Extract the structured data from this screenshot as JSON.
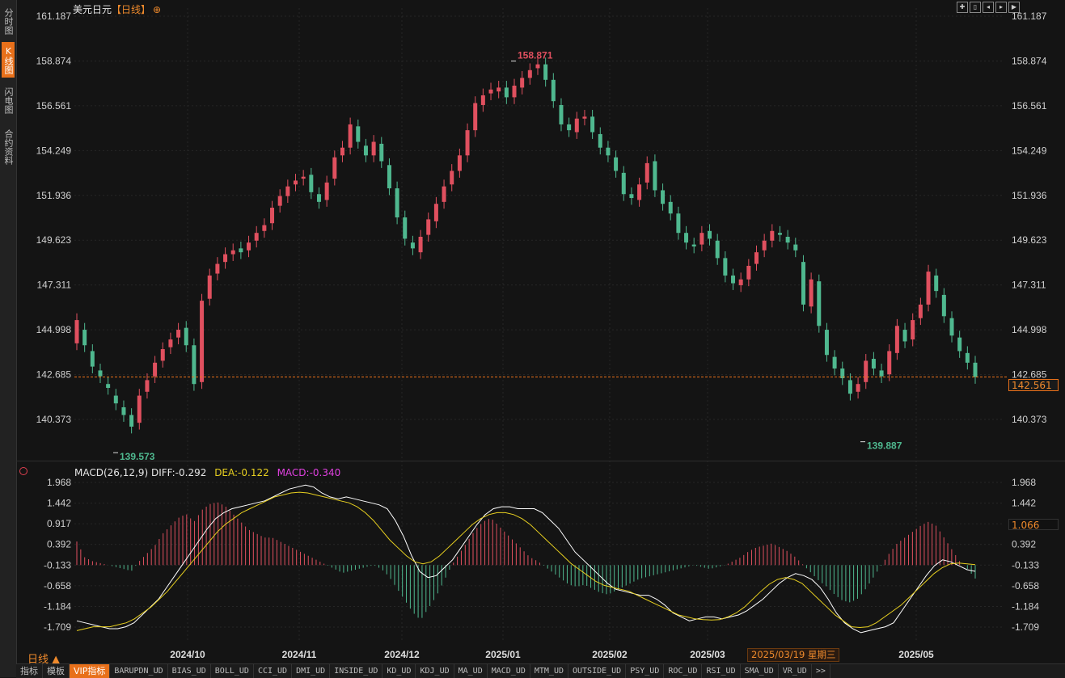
{
  "sidebar": {
    "tabs": [
      {
        "label": "分时图",
        "active": false
      },
      {
        "label": "K线图",
        "active": true
      },
      {
        "label": "闪电图",
        "active": false
      },
      {
        "label": "合约资料",
        "active": false
      }
    ]
  },
  "header": {
    "symbol": "美元日元",
    "period": "【日线】",
    "add_icon": "add-circle-icon"
  },
  "window_controls": [
    "expand-icon",
    "split-icon",
    "prev-icon",
    "next-icon",
    "play-icon"
  ],
  "price_axis": {
    "ticks": [
      "161.187",
      "158.874",
      "156.561",
      "154.249",
      "151.936",
      "149.623",
      "147.311",
      "144.998",
      "142.685",
      "140.373"
    ],
    "current_price": "142.561",
    "right_ticks": [
      "161.187",
      "158.874",
      "156.561",
      "154.249",
      "151.936",
      "149.623",
      "147.311",
      "144.998",
      "142.685",
      "140.373"
    ]
  },
  "annotations": {
    "high": "158.871",
    "low1": "139.573",
    "low2": "139.887"
  },
  "macd": {
    "title": "MACD(26,12,9)",
    "diff": "DIFF:-0.292",
    "dea": "DEA:-0.122",
    "macd": "MACD:-0.340",
    "ticks": [
      "1.968",
      "1.442",
      "0.917",
      "0.392",
      "-0.133",
      "-0.658",
      "-1.184",
      "-1.709"
    ],
    "right_ticks": [
      "1.968",
      "1.442",
      "0.917",
      "0.392",
      "-0.133",
      "-0.658",
      "-1.184",
      "-1.709"
    ],
    "cursor_value": "1.066"
  },
  "time_axis": {
    "labels": [
      "2024/10",
      "2024/11",
      "2024/12",
      "2025/01",
      "2025/02",
      "2025/03",
      "2025/05"
    ],
    "cursor_date": "2025/03/19 星期三"
  },
  "period_toggle": "日线 ▲",
  "bottom_tabs": [
    {
      "label": "指标",
      "active": false
    },
    {
      "label": "模板",
      "active": false
    },
    {
      "label": "VIP指标",
      "active": true
    },
    {
      "label": "BARUPDN_UD",
      "active": false
    },
    {
      "label": "BIAS_UD",
      "active": false
    },
    {
      "label": "BOLL_UD",
      "active": false
    },
    {
      "label": "CCI_UD",
      "active": false
    },
    {
      "label": "DMI_UD",
      "active": false
    },
    {
      "label": "INSIDE_UD",
      "active": false
    },
    {
      "label": "KD_UD",
      "active": false
    },
    {
      "label": "KDJ_UD",
      "active": false
    },
    {
      "label": "MA_UD",
      "active": false
    },
    {
      "label": "MACD_UD",
      "active": false
    },
    {
      "label": "MTM_UD",
      "active": false
    },
    {
      "label": "OUTSIDE_UD",
      "active": false
    },
    {
      "label": "PSY_UD",
      "active": false
    },
    {
      "label": "ROC_UD",
      "active": false
    },
    {
      "label": "RSI_UD",
      "active": false
    },
    {
      "label": "SMA_UD",
      "active": false
    },
    {
      "label": "VR_UD",
      "active": false
    },
    {
      "label": ">>",
      "active": false
    }
  ],
  "colors": {
    "up": "#e0505f",
    "down": "#4fb88f",
    "diff_line": "#ffffff",
    "dea_line": "#e8d020",
    "accent": "#e8701a",
    "price_line": "#e8701a"
  },
  "chart_data": [
    {
      "type": "candlestick",
      "title": "美元日元",
      "ylim": [
        139.0,
        161.187
      ],
      "x_labels": [
        "2024/10",
        "2024/11",
        "2024/12",
        "2025/01",
        "2025/02",
        "2025/03",
        "2025/05"
      ],
      "closes": [
        145.5,
        144.2,
        143.1,
        142.6,
        142.0,
        141.2,
        140.6,
        140.0,
        141.6,
        142.4,
        143.3,
        144.0,
        144.5,
        145.0,
        144.2,
        142.2,
        146.5,
        147.8,
        148.4,
        148.9,
        149.1,
        149.0,
        149.5,
        150.0,
        150.4,
        151.3,
        151.9,
        152.4,
        152.7,
        152.9,
        152.1,
        151.6,
        152.6,
        153.9,
        154.4,
        155.6,
        154.7,
        154.0,
        154.7,
        153.7,
        152.3,
        150.8,
        149.7,
        149.2,
        149.8,
        150.7,
        151.5,
        152.4,
        153.2,
        154.0,
        155.3,
        156.7,
        157.1,
        157.4,
        157.5,
        157.0,
        157.6,
        158.0,
        158.4,
        158.7,
        157.9,
        156.8,
        155.6,
        155.3,
        155.9,
        156.0,
        155.2,
        154.4,
        154.0,
        153.2,
        152.0,
        151.8,
        152.5,
        153.6,
        152.2,
        151.5,
        151.0,
        150.0,
        149.5,
        149.3,
        150.0,
        149.7,
        148.7,
        147.8,
        147.4,
        147.6,
        148.3,
        149.0,
        149.6,
        150.1,
        149.9,
        149.5,
        149.1,
        146.3,
        147.6,
        145.2,
        143.7,
        143.0,
        142.5,
        141.7,
        142.2,
        143.4,
        143.0,
        142.6,
        143.9,
        145.2,
        144.4,
        145.5,
        146.3,
        148.0,
        147.0,
        145.7,
        144.7,
        143.9,
        143.3,
        142.561
      ],
      "opens": [
        144.3,
        145.0,
        143.9,
        142.9,
        142.2,
        141.6,
        141.0,
        140.6,
        140.2,
        141.8,
        142.6,
        143.4,
        144.1,
        144.6,
        145.1,
        144.2,
        142.3,
        146.6,
        147.9,
        148.5,
        148.9,
        149.2,
        149.1,
        149.6,
        150.1,
        150.5,
        151.4,
        151.9,
        152.5,
        152.8,
        153.0,
        152.0,
        151.7,
        152.8,
        154.0,
        154.4,
        155.5,
        154.5,
        154.0,
        154.6,
        153.5,
        152.3,
        150.8,
        149.5,
        149.0,
        149.9,
        150.6,
        151.6,
        152.5,
        153.2,
        154.0,
        155.3,
        156.6,
        157.2,
        157.3,
        157.5,
        157.0,
        157.5,
        158.0,
        158.5,
        158.7,
        157.9,
        156.6,
        155.6,
        155.2,
        155.9,
        156.0,
        155.1,
        154.4,
        153.9,
        153.1,
        152.0,
        151.7,
        152.6,
        153.7,
        152.2,
        151.6,
        151.0,
        150.0,
        149.4,
        149.4,
        150.1,
        149.6,
        148.7,
        147.8,
        147.3,
        147.6,
        148.4,
        149.1,
        149.6,
        150.0,
        149.8,
        149.4,
        148.5,
        146.2,
        147.5,
        145.0,
        143.6,
        143.0,
        142.4,
        141.8,
        142.3,
        143.5,
        142.9,
        142.7,
        143.8,
        145.0,
        144.5,
        145.6,
        146.3,
        147.8,
        146.8,
        145.6,
        144.6,
        143.8,
        143.3
      ]
    },
    {
      "type": "bar",
      "title": "MACD(26,12,9)",
      "ylim": [
        -2.0,
        1.968
      ],
      "series": [
        {
          "name": "MACD",
          "values": [
            0.6,
            0.2,
            0.1,
            0.05,
            0.0,
            -0.05,
            -0.1,
            -0.15,
            0.1,
            0.3,
            0.5,
            0.8,
            1.0,
            1.2,
            1.3,
            1.1,
            1.4,
            1.55,
            1.6,
            1.5,
            1.3,
            1.1,
            0.9,
            0.8,
            0.7,
            0.7,
            0.6,
            0.5,
            0.4,
            0.3,
            0.2,
            0.1,
            0.0,
            -0.1,
            -0.2,
            -0.15,
            -0.1,
            -0.05,
            0.0,
            -0.1,
            -0.3,
            -0.6,
            -0.9,
            -1.2,
            -1.4,
            -1.1,
            -0.8,
            -0.4,
            0.0,
            0.3,
            0.6,
            0.9,
            1.1,
            1.2,
            1.0,
            0.8,
            0.6,
            0.4,
            0.2,
            0.1,
            -0.05,
            -0.2,
            -0.35,
            -0.5,
            -0.55,
            -0.5,
            -0.6,
            -0.7,
            -0.75,
            -0.65,
            -0.55,
            -0.45,
            -0.35,
            -0.3,
            -0.25,
            -0.2,
            -0.15,
            -0.1,
            -0.05,
            0.0,
            -0.05,
            -0.1,
            -0.05,
            0.0,
            0.1,
            0.2,
            0.35,
            0.45,
            0.5,
            0.55,
            0.45,
            0.35,
            0.2,
            0.0,
            -0.2,
            -0.4,
            -0.55,
            -0.75,
            -0.9,
            -0.95,
            -0.85,
            -0.6,
            -0.3,
            0.0,
            0.3,
            0.55,
            0.7,
            0.85,
            1.0,
            1.1,
            1.0,
            0.7,
            0.4,
            0.1,
            -0.1,
            -0.34
          ]
        },
        {
          "name": "DIFF",
          "values": [
            -1.55,
            -1.6,
            -1.65,
            -1.7,
            -1.75,
            -1.75,
            -1.7,
            -1.6,
            -1.4,
            -1.2,
            -1.0,
            -0.7,
            -0.4,
            -0.1,
            0.2,
            0.5,
            0.8,
            1.05,
            1.2,
            1.3,
            1.35,
            1.4,
            1.45,
            1.5,
            1.6,
            1.7,
            1.8,
            1.85,
            1.9,
            1.85,
            1.7,
            1.6,
            1.55,
            1.6,
            1.55,
            1.5,
            1.45,
            1.4,
            1.3,
            1.0,
            0.6,
            0.1,
            -0.3,
            -0.45,
            -0.4,
            -0.2,
            0.0,
            0.3,
            0.6,
            0.9,
            1.15,
            1.3,
            1.35,
            1.35,
            1.3,
            1.3,
            1.3,
            1.2,
            1.0,
            0.8,
            0.5,
            0.2,
            0.0,
            -0.2,
            -0.4,
            -0.6,
            -0.75,
            -0.8,
            -0.85,
            -0.9,
            -0.9,
            -1.0,
            -1.15,
            -1.35,
            -1.45,
            -1.55,
            -1.5,
            -1.45,
            -1.45,
            -1.5,
            -1.45,
            -1.4,
            -1.3,
            -1.15,
            -1.0,
            -0.8,
            -0.6,
            -0.45,
            -0.35,
            -0.4,
            -0.5,
            -0.7,
            -1.0,
            -1.35,
            -1.6,
            -1.75,
            -1.85,
            -1.8,
            -1.75,
            -1.7,
            -1.6,
            -1.3,
            -1.0,
            -0.7,
            -0.4,
            -0.15,
            0.0,
            -0.05,
            -0.15,
            -0.25,
            -0.292
          ]
        },
        {
          "name": "DEA",
          "values": [
            -1.8,
            -1.75,
            -1.7,
            -1.7,
            -1.7,
            -1.65,
            -1.6,
            -1.5,
            -1.35,
            -1.2,
            -1.0,
            -0.8,
            -0.55,
            -0.3,
            -0.05,
            0.2,
            0.45,
            0.7,
            0.9,
            1.05,
            1.2,
            1.3,
            1.4,
            1.5,
            1.6,
            1.65,
            1.7,
            1.72,
            1.7,
            1.65,
            1.6,
            1.55,
            1.5,
            1.45,
            1.35,
            1.2,
            1.0,
            0.75,
            0.5,
            0.3,
            0.1,
            -0.05,
            -0.1,
            -0.05,
            0.1,
            0.3,
            0.5,
            0.7,
            0.9,
            1.05,
            1.15,
            1.2,
            1.2,
            1.15,
            1.05,
            0.9,
            0.7,
            0.5,
            0.3,
            0.1,
            -0.1,
            -0.25,
            -0.4,
            -0.55,
            -0.65,
            -0.7,
            -0.75,
            -0.8,
            -0.9,
            -1.0,
            -1.1,
            -1.2,
            -1.3,
            -1.4,
            -1.45,
            -1.5,
            -1.52,
            -1.53,
            -1.52,
            -1.45,
            -1.35,
            -1.2,
            -1.0,
            -0.8,
            -0.62,
            -0.5,
            -0.45,
            -0.5,
            -0.6,
            -0.8,
            -1.0,
            -1.2,
            -1.4,
            -1.55,
            -1.7,
            -1.72,
            -1.7,
            -1.6,
            -1.45,
            -1.3,
            -1.15,
            -0.95,
            -0.75,
            -0.55,
            -0.35,
            -0.2,
            -0.1,
            -0.08,
            -0.1,
            -0.122
          ]
        }
      ]
    }
  ]
}
